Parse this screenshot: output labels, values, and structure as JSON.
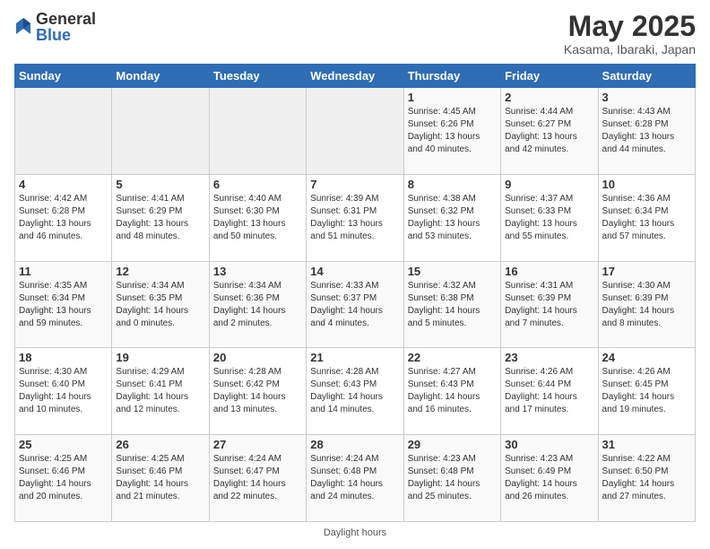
{
  "logo": {
    "general": "General",
    "blue": "Blue"
  },
  "title": "May 2025",
  "location": "Kasama, Ibaraki, Japan",
  "weekdays": [
    "Sunday",
    "Monday",
    "Tuesday",
    "Wednesday",
    "Thursday",
    "Friday",
    "Saturday"
  ],
  "weeks": [
    [
      {
        "day": "",
        "sunrise": "",
        "sunset": "",
        "daylight": "",
        "empty": true
      },
      {
        "day": "",
        "sunrise": "",
        "sunset": "",
        "daylight": "",
        "empty": true
      },
      {
        "day": "",
        "sunrise": "",
        "sunset": "",
        "daylight": "",
        "empty": true
      },
      {
        "day": "",
        "sunrise": "",
        "sunset": "",
        "daylight": "",
        "empty": true
      },
      {
        "day": "1",
        "sunrise": "Sunrise: 4:45 AM",
        "sunset": "Sunset: 6:26 PM",
        "daylight": "Daylight: 13 hours and 40 minutes.",
        "empty": false
      },
      {
        "day": "2",
        "sunrise": "Sunrise: 4:44 AM",
        "sunset": "Sunset: 6:27 PM",
        "daylight": "Daylight: 13 hours and 42 minutes.",
        "empty": false
      },
      {
        "day": "3",
        "sunrise": "Sunrise: 4:43 AM",
        "sunset": "Sunset: 6:28 PM",
        "daylight": "Daylight: 13 hours and 44 minutes.",
        "empty": false
      }
    ],
    [
      {
        "day": "4",
        "sunrise": "Sunrise: 4:42 AM",
        "sunset": "Sunset: 6:28 PM",
        "daylight": "Daylight: 13 hours and 46 minutes.",
        "empty": false
      },
      {
        "day": "5",
        "sunrise": "Sunrise: 4:41 AM",
        "sunset": "Sunset: 6:29 PM",
        "daylight": "Daylight: 13 hours and 48 minutes.",
        "empty": false
      },
      {
        "day": "6",
        "sunrise": "Sunrise: 4:40 AM",
        "sunset": "Sunset: 6:30 PM",
        "daylight": "Daylight: 13 hours and 50 minutes.",
        "empty": false
      },
      {
        "day": "7",
        "sunrise": "Sunrise: 4:39 AM",
        "sunset": "Sunset: 6:31 PM",
        "daylight": "Daylight: 13 hours and 51 minutes.",
        "empty": false
      },
      {
        "day": "8",
        "sunrise": "Sunrise: 4:38 AM",
        "sunset": "Sunset: 6:32 PM",
        "daylight": "Daylight: 13 hours and 53 minutes.",
        "empty": false
      },
      {
        "day": "9",
        "sunrise": "Sunrise: 4:37 AM",
        "sunset": "Sunset: 6:33 PM",
        "daylight": "Daylight: 13 hours and 55 minutes.",
        "empty": false
      },
      {
        "day": "10",
        "sunrise": "Sunrise: 4:36 AM",
        "sunset": "Sunset: 6:34 PM",
        "daylight": "Daylight: 13 hours and 57 minutes.",
        "empty": false
      }
    ],
    [
      {
        "day": "11",
        "sunrise": "Sunrise: 4:35 AM",
        "sunset": "Sunset: 6:34 PM",
        "daylight": "Daylight: 13 hours and 59 minutes.",
        "empty": false
      },
      {
        "day": "12",
        "sunrise": "Sunrise: 4:34 AM",
        "sunset": "Sunset: 6:35 PM",
        "daylight": "Daylight: 14 hours and 0 minutes.",
        "empty": false
      },
      {
        "day": "13",
        "sunrise": "Sunrise: 4:34 AM",
        "sunset": "Sunset: 6:36 PM",
        "daylight": "Daylight: 14 hours and 2 minutes.",
        "empty": false
      },
      {
        "day": "14",
        "sunrise": "Sunrise: 4:33 AM",
        "sunset": "Sunset: 6:37 PM",
        "daylight": "Daylight: 14 hours and 4 minutes.",
        "empty": false
      },
      {
        "day": "15",
        "sunrise": "Sunrise: 4:32 AM",
        "sunset": "Sunset: 6:38 PM",
        "daylight": "Daylight: 14 hours and 5 minutes.",
        "empty": false
      },
      {
        "day": "16",
        "sunrise": "Sunrise: 4:31 AM",
        "sunset": "Sunset: 6:39 PM",
        "daylight": "Daylight: 14 hours and 7 minutes.",
        "empty": false
      },
      {
        "day": "17",
        "sunrise": "Sunrise: 4:30 AM",
        "sunset": "Sunset: 6:39 PM",
        "daylight": "Daylight: 14 hours and 8 minutes.",
        "empty": false
      }
    ],
    [
      {
        "day": "18",
        "sunrise": "Sunrise: 4:30 AM",
        "sunset": "Sunset: 6:40 PM",
        "daylight": "Daylight: 14 hours and 10 minutes.",
        "empty": false
      },
      {
        "day": "19",
        "sunrise": "Sunrise: 4:29 AM",
        "sunset": "Sunset: 6:41 PM",
        "daylight": "Daylight: 14 hours and 12 minutes.",
        "empty": false
      },
      {
        "day": "20",
        "sunrise": "Sunrise: 4:28 AM",
        "sunset": "Sunset: 6:42 PM",
        "daylight": "Daylight: 14 hours and 13 minutes.",
        "empty": false
      },
      {
        "day": "21",
        "sunrise": "Sunrise: 4:28 AM",
        "sunset": "Sunset: 6:43 PM",
        "daylight": "Daylight: 14 hours and 14 minutes.",
        "empty": false
      },
      {
        "day": "22",
        "sunrise": "Sunrise: 4:27 AM",
        "sunset": "Sunset: 6:43 PM",
        "daylight": "Daylight: 14 hours and 16 minutes.",
        "empty": false
      },
      {
        "day": "23",
        "sunrise": "Sunrise: 4:26 AM",
        "sunset": "Sunset: 6:44 PM",
        "daylight": "Daylight: 14 hours and 17 minutes.",
        "empty": false
      },
      {
        "day": "24",
        "sunrise": "Sunrise: 4:26 AM",
        "sunset": "Sunset: 6:45 PM",
        "daylight": "Daylight: 14 hours and 19 minutes.",
        "empty": false
      }
    ],
    [
      {
        "day": "25",
        "sunrise": "Sunrise: 4:25 AM",
        "sunset": "Sunset: 6:46 PM",
        "daylight": "Daylight: 14 hours and 20 minutes.",
        "empty": false
      },
      {
        "day": "26",
        "sunrise": "Sunrise: 4:25 AM",
        "sunset": "Sunset: 6:46 PM",
        "daylight": "Daylight: 14 hours and 21 minutes.",
        "empty": false
      },
      {
        "day": "27",
        "sunrise": "Sunrise: 4:24 AM",
        "sunset": "Sunset: 6:47 PM",
        "daylight": "Daylight: 14 hours and 22 minutes.",
        "empty": false
      },
      {
        "day": "28",
        "sunrise": "Sunrise: 4:24 AM",
        "sunset": "Sunset: 6:48 PM",
        "daylight": "Daylight: 14 hours and 24 minutes.",
        "empty": false
      },
      {
        "day": "29",
        "sunrise": "Sunrise: 4:23 AM",
        "sunset": "Sunset: 6:48 PM",
        "daylight": "Daylight: 14 hours and 25 minutes.",
        "empty": false
      },
      {
        "day": "30",
        "sunrise": "Sunrise: 4:23 AM",
        "sunset": "Sunset: 6:49 PM",
        "daylight": "Daylight: 14 hours and 26 minutes.",
        "empty": false
      },
      {
        "day": "31",
        "sunrise": "Sunrise: 4:22 AM",
        "sunset": "Sunset: 6:50 PM",
        "daylight": "Daylight: 14 hours and 27 minutes.",
        "empty": false
      }
    ]
  ],
  "footer": "Daylight hours"
}
